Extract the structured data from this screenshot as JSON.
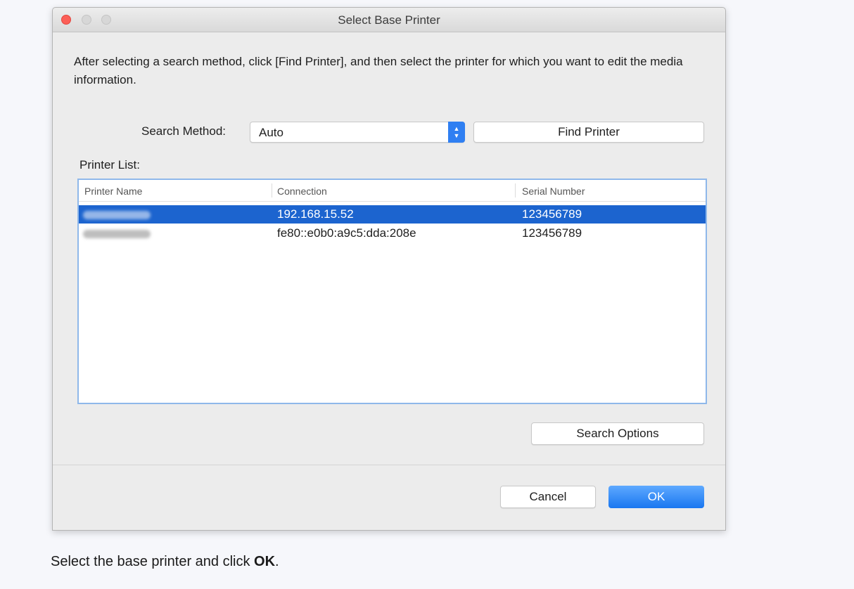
{
  "window": {
    "title": "Select Base Printer",
    "instructions": "After selecting a search method, click [Find Printer], and then select the printer for which you want to edit the media information."
  },
  "search": {
    "label": "Search Method:",
    "selected": "Auto",
    "find_button": "Find Printer"
  },
  "printer_list": {
    "label": "Printer List:",
    "columns": [
      "Printer Name",
      "Connection",
      "Serial Number"
    ],
    "rows": [
      {
        "name": "",
        "connection": "192.168.15.52",
        "serial": "123456789",
        "selected": true
      },
      {
        "name": "",
        "connection": "fe80::e0b0:a9c5:dda:208e",
        "serial": "123456789",
        "selected": false
      }
    ]
  },
  "buttons": {
    "search_options": "Search Options",
    "cancel": "Cancel",
    "ok": "OK"
  },
  "caption": {
    "prefix": "Select the base printer and click ",
    "emphasis": "OK",
    "suffix": "."
  },
  "colors": {
    "selection": "#1c64cf",
    "accent": "#2f7ff2",
    "close": "#fc5f57"
  }
}
